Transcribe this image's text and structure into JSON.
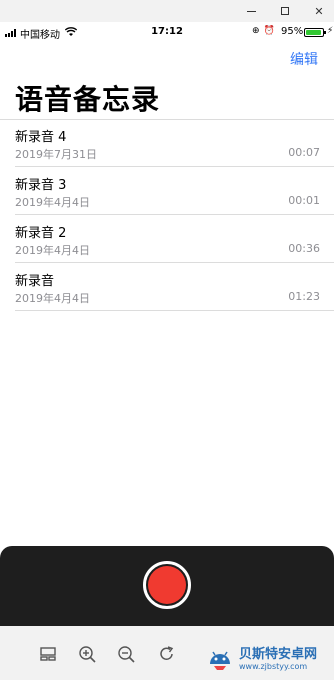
{
  "window": {
    "min_icon": "minimize-icon",
    "max_icon": "maximize-icon",
    "close_icon": "close-icon",
    "close_glyph": "✕"
  },
  "status": {
    "carrier": "中国移动",
    "time": "17:12",
    "battery_pct": "95%",
    "battery_level": 0.95,
    "icons": [
      "⊕",
      "⏰"
    ]
  },
  "nav": {
    "edit_label": "编辑",
    "title": "语音备忘录"
  },
  "recordings": [
    {
      "name": "新录音 4",
      "date": "2019年7月31日",
      "duration": "00:07"
    },
    {
      "name": "新录音 3",
      "date": "2019年4月4日",
      "duration": "00:01"
    },
    {
      "name": "新录音 2",
      "date": "2019年4月4日",
      "duration": "00:36"
    },
    {
      "name": "新录音",
      "date": "2019年4月4日",
      "duration": "01:23"
    }
  ],
  "record": {
    "accent": "#f03a30"
  },
  "toolbar": {
    "icons": [
      "layout-icon",
      "zoom-in-icon",
      "zoom-out-icon",
      "rotate-icon"
    ]
  },
  "watermark": {
    "title": "贝斯特安卓网",
    "url": "www.zjbstyy.com"
  }
}
